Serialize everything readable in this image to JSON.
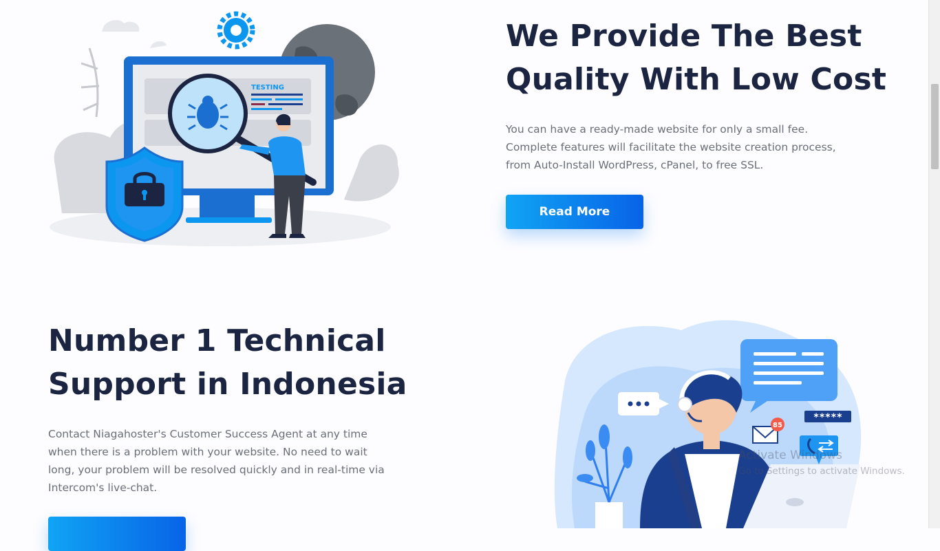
{
  "section_quality": {
    "title": "We Provide The Best Quality With Low Cost",
    "description": "You can have a ready-made website for only a small fee. Complete features will facilitate the website creation process, from Auto-Install WordPress, cPanel, to free SSL.",
    "button_label": "Read More",
    "illustration": {
      "screen_label": "TESTING",
      "icons": [
        "gear-icon",
        "bug-icon",
        "lock-icon",
        "magnifier-icon"
      ]
    }
  },
  "section_support": {
    "title": "Number 1 Technical Support in Indonesia",
    "description": "Contact Niagahoster's Customer Success Agent at any time when there is a problem with your website. No need to wait long, your problem will be resolved quickly and in real-time via Intercom's live-chat.",
    "illustration": {
      "password_mask": "*****",
      "notification_count": "85",
      "icons": [
        "chat-bubble-icon",
        "envelope-icon",
        "phone-transfer-icon",
        "headset-icon"
      ]
    }
  },
  "watermark": {
    "title": "Activate Windows",
    "subtitle": "Go to Settings to activate Windows."
  },
  "colors": {
    "heading": "#1b2440",
    "body_text": "#6a6e78",
    "button_start": "#10a4f4",
    "button_end": "#0863e7",
    "accent_blue": "#0b96f0"
  }
}
